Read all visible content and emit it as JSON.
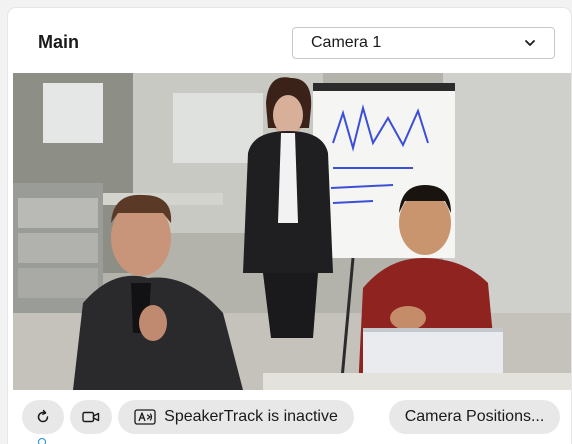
{
  "panel": {
    "title": "Main",
    "camera_select": {
      "selected": "Camera 1",
      "icon": "chevron-down-icon"
    }
  },
  "video": {
    "description_icon": "camera-feed"
  },
  "controls": {
    "refresh_icon": "refresh-icon",
    "camera_icon": "video-camera-icon",
    "speakertrack_icon": "speakertrack-icon",
    "speakertrack_label": "SpeakerTrack is inactive",
    "camera_positions_label": "Camera Positions..."
  },
  "colors": {
    "panel_bg": "#ffffff",
    "page_bg": "#f2f2f2",
    "pill_bg": "#e8e8e8",
    "accent": "#1a8fd6"
  }
}
